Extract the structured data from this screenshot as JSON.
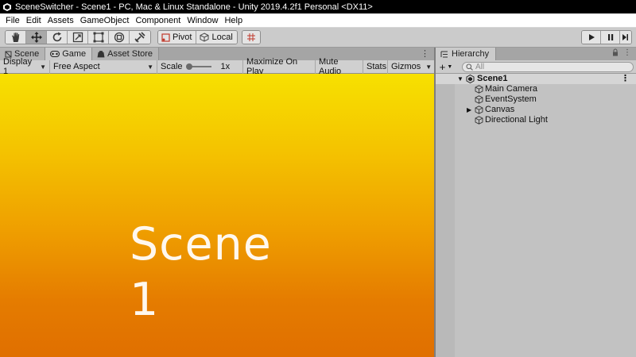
{
  "window": {
    "title": "SceneSwitcher - Scene1 - PC, Mac & Linux Standalone - Unity 2019.4.2f1 Personal <DX11>"
  },
  "menu": [
    "File",
    "Edit",
    "Assets",
    "GameObject",
    "Component",
    "Window",
    "Help"
  ],
  "toolbar": {
    "tools": [
      "hand-icon",
      "move-icon",
      "rotate-icon",
      "scale-icon",
      "rect-icon",
      "transform-icon",
      "custom-tool-icon"
    ],
    "active_tool": "move-icon",
    "pivot_label": "Pivot",
    "local_label": "Local",
    "grid_snap_icon": "grid-snap-icon",
    "play_controls": [
      "play-icon",
      "pause-icon",
      "step-icon"
    ]
  },
  "left_panel": {
    "tabs": [
      {
        "label": "Scene",
        "icon": "scene-tab-icon",
        "active": false
      },
      {
        "label": "Game",
        "icon": "game-tab-icon",
        "active": true
      },
      {
        "label": "Asset Store",
        "icon": "store-tab-icon",
        "active": false
      }
    ],
    "menu_glyph": "⋮",
    "game_toolbar": {
      "display": "Display 1",
      "aspect": "Free Aspect",
      "scale_label": "Scale",
      "scale_value": "1x",
      "maximize_on_play": "Maximize On Play",
      "mute_audio": "Mute Audio",
      "stats": "Stats",
      "gizmos": "Gizmos"
    },
    "game_view": {
      "text": "Scene 1",
      "gradient_top": "#f7e100",
      "gradient_bottom": "#e06f00"
    }
  },
  "hierarchy": {
    "tab_label": "Hierarchy",
    "add_label": "+",
    "search_placeholder": "All",
    "scene_name": "Scene1",
    "menu_glyph": "⋮",
    "items": [
      {
        "label": "Main Camera",
        "has_children": false
      },
      {
        "label": "EventSystem",
        "has_children": false
      },
      {
        "label": "Canvas",
        "has_children": true
      },
      {
        "label": "Directional Light",
        "has_children": false
      }
    ]
  },
  "colors": {
    "title_bar": "#000000",
    "panel_bg": "#c2c2c2",
    "tab_bg": "#a5a5a5"
  }
}
